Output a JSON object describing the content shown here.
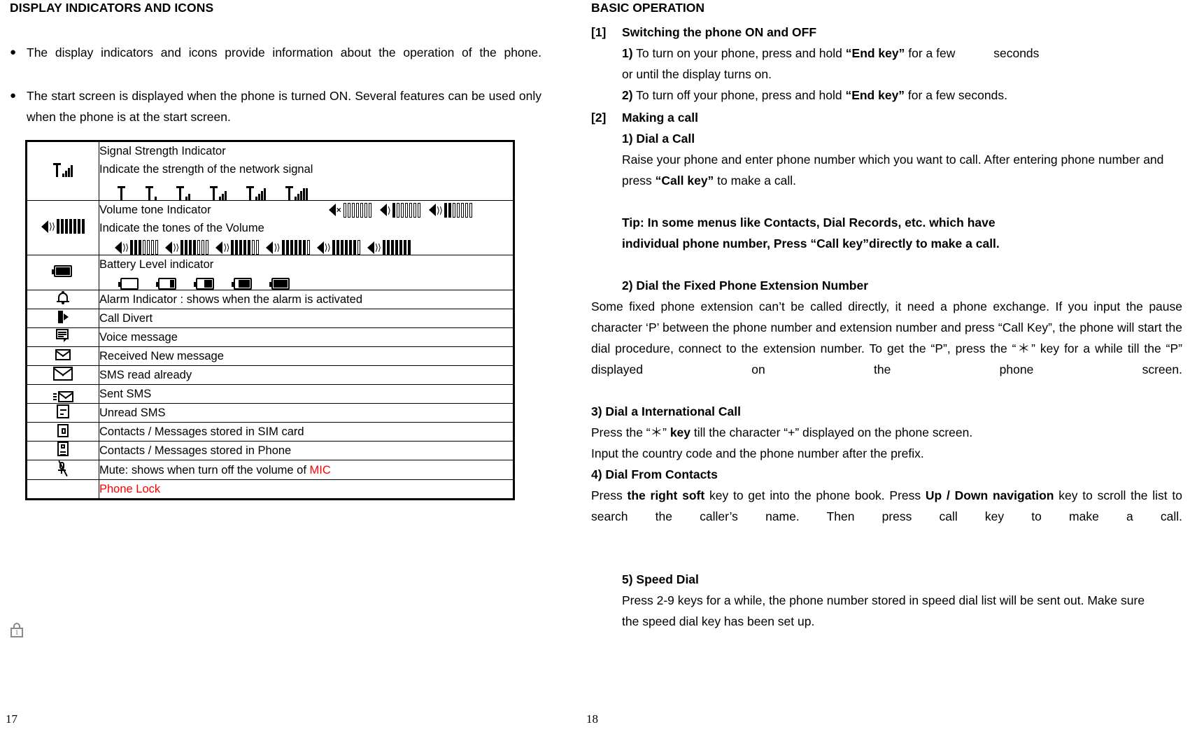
{
  "left": {
    "section_title": "DISPLAY INDICATORS AND ICONS",
    "bullets": [
      "The display indicators and icons provide information about the operation of the phone.",
      "The start screen is displayed when the phone is turned ON. Several features can be used only when the phone is at the start screen."
    ],
    "table_rows": [
      {
        "icon": "signal-strength-icon",
        "lines": [
          "Signal Strength Indicator",
          "Indicate the strength of the network signal"
        ],
        "variants": "signal-levels-0-to-5"
      },
      {
        "icon": "volume-tone-icon",
        "lines": [
          "Volume tone Indicator",
          "Indicate the tones of the Volume"
        ],
        "variants": "volume-levels"
      },
      {
        "icon": "battery-level-icon",
        "lines": [
          "Battery Level indicator"
        ],
        "variants": "battery-levels-0-to-4"
      },
      {
        "icon": "alarm-bell-icon",
        "lines": [
          "Alarm Indicator : shows when the alarm is activated"
        ],
        "variants": ""
      },
      {
        "icon": "call-divert-icon",
        "lines": [
          "Call Divert"
        ],
        "variants": ""
      },
      {
        "icon": "voice-message-icon",
        "lines": [
          "Voice message"
        ],
        "variants": ""
      },
      {
        "icon": "received-new-message-icon",
        "lines": [
          "Received New message"
        ],
        "variants": ""
      },
      {
        "icon": "sms-read-icon",
        "lines": [
          "SMS read already"
        ],
        "variants": ""
      },
      {
        "icon": "sent-sms-icon",
        "lines": [
          "Sent SMS"
        ],
        "variants": ""
      },
      {
        "icon": "unread-sms-icon",
        "lines": [
          "Unread SMS"
        ],
        "variants": ""
      },
      {
        "icon": "sim-card-icon",
        "lines": [
          "Contacts / Messages stored in SIM card"
        ],
        "variants": ""
      },
      {
        "icon": "phone-memory-icon",
        "lines": [
          "Contacts / Messages stored in Phone"
        ],
        "variants": ""
      },
      {
        "icon": "mute-mic-icon",
        "lines": [
          "Mute: shows when turn off the volume of "
        ],
        "lines_red": "MIC",
        "variants": ""
      },
      {
        "icon": "phone-lock-icon",
        "lines": [
          ""
        ],
        "lines_red": "Phone Lock",
        "variants": ""
      }
    ],
    "mute_text_plain": "Mute: shows when turn off the volume of ",
    "mute_text_red": "MIC",
    "phone_lock_text": "Phone Lock",
    "lock_icon_digit": "1",
    "page_number": "17"
  },
  "right": {
    "section_title": "BASIC OPERATION",
    "item1": {
      "tag": "[1]",
      "head": "Switching the phone ON and OFF",
      "sub1_num": "1)",
      "sub1_a": " To turn on your phone, press and hold ",
      "sub1_bold": "“End key”",
      "sub1_b": " for a few ",
      "sub1_c": "seconds",
      "sub1_line2": "or until the display turns on.",
      "sub2_num": "2)",
      "sub2_a": " To turn off your phone, press and hold ",
      "sub2_bold": "“End key”",
      "sub2_b": " for a few seconds."
    },
    "item2": {
      "tag": "[2]",
      "head": "Making a call",
      "sub1_head": "1) Dial a Call",
      "sub1_body_a": "Raise your phone and enter phone number which you want to call. After entering phone number and press ",
      "sub1_body_bold": "“Call key”",
      "sub1_body_b": " to make a call.",
      "tip_line1": "Tip: In some menus like Contacts, Dial Records, etc. which have",
      "tip_line2": "individual phone number, Press “Call key”directly to make a call.",
      "sub2_head": "2) Dial the Fixed Phone Extension Number",
      "sub2_body": "Some fixed phone extension can’t be called directly, it need a phone exchange. If you input the pause character ‘P’ between the phone number and extension number and press “Call Key”, the phone will start the dial procedure, connect to the extension number. To get the “P”, press the “＊” key for a while till the “P” displayed on the phone screen.",
      "sub3_head": "3) Dial a International Call",
      "sub3_body_a": "Press the “＊” ",
      "sub3_body_bold": "key",
      "sub3_body_b": " till the character “+” displayed on the phone screen.",
      "sub3_body_line2": "Input the country code and the phone number after the prefix.",
      "sub4_head": "4) Dial From Contacts",
      "sub4_a": "Press ",
      "sub4_bold1": "the right soft",
      "sub4_b": " key to get into the phone book. Press ",
      "sub4_bold2": "Up / Down navigation",
      "sub4_c": " key to scroll the list to search the caller’s name. Then press call key to make a call.",
      "sub5_head": "5) Speed Dial",
      "sub5_body": "Press 2-9 keys for a while, the phone number stored in speed dial list will be sent out. Make sure the speed dial key has been set up."
    },
    "page_number": "18"
  }
}
